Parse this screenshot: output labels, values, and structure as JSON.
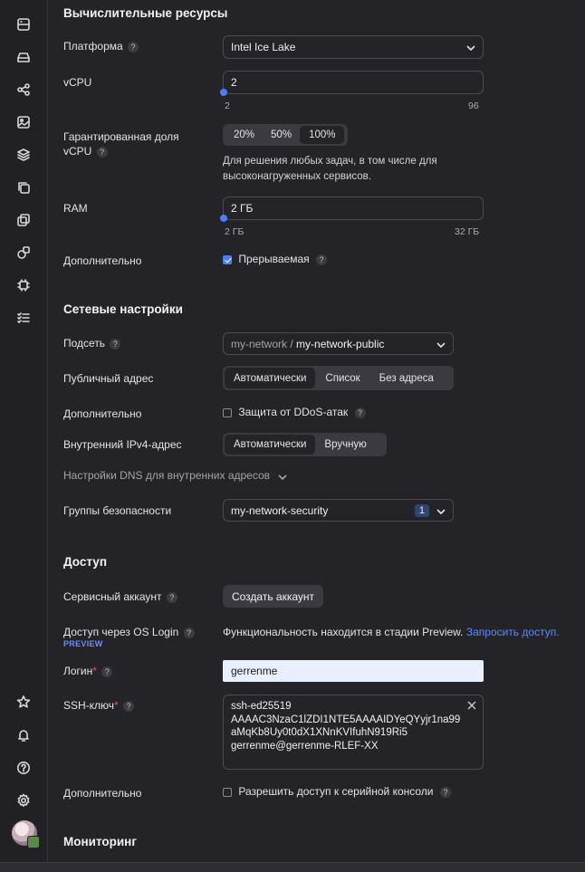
{
  "sidebar": {
    "icons": [
      "compute-icon",
      "disk-icon",
      "network-icon",
      "image-icon",
      "layers-icon",
      "copy-icon",
      "clone-icon",
      "shapes-icon",
      "chip-icon",
      "list-check-icon"
    ],
    "bottom_icons": [
      "star-icon",
      "bell-icon",
      "help-icon",
      "settings-icon"
    ]
  },
  "compute": {
    "title": "Вычислительные ресурсы",
    "platform_label": "Платформа",
    "platform_value": "Intel Ice Lake",
    "vcpu_label": "vCPU",
    "vcpu_value": "2",
    "vcpu_min": "2",
    "vcpu_max": "96",
    "guaranteed_label_1": "Гарантированная доля",
    "guaranteed_label_2": "vCPU",
    "guaranteed_options": [
      "20%",
      "50%",
      "100%"
    ],
    "guaranteed_selected": "100%",
    "guaranteed_help_1": "Для решения любых задач, в том числе для",
    "guaranteed_help_2": "высоконагруженных сервисов.",
    "ram_label": "RAM",
    "ram_value": "2 ГБ",
    "ram_min": "2 ГБ",
    "ram_max": "32 ГБ",
    "extra_label": "Дополнительно",
    "preemptible_label": "Прерываемая",
    "preemptible_checked": true
  },
  "network": {
    "title": "Сетевые настройки",
    "subnet_label": "Подсеть",
    "subnet_prefix": "my-network /",
    "subnet_value": "my-network-public",
    "public_address_label": "Публичный адрес",
    "public_address_options": [
      "Автоматически",
      "Список",
      "Без адреса"
    ],
    "public_address_selected": "Автоматически",
    "extra_label": "Дополнительно",
    "ddos_label": "Защита от DDoS-атак",
    "ddos_checked": false,
    "internal_ipv4_label": "Внутренний IPv4-адрес",
    "internal_ipv4_options": [
      "Автоматически",
      "Вручную"
    ],
    "internal_ipv4_selected": "Автоматически",
    "dns_settings_label": "Настройки DNS для внутренних адресов",
    "security_groups_label": "Группы безопасности",
    "security_groups_value": "my-network-security",
    "security_groups_count": "1"
  },
  "access": {
    "title": "Доступ",
    "service_account_label": "Сервисный аккаунт",
    "create_account_button": "Создать аккаунт",
    "os_login_label": "Доступ через OS Login",
    "os_login_badge": "PREVIEW",
    "os_login_text": "Функциональность находится в стадии Preview.",
    "os_login_link": "Запросить доступ.",
    "login_label": "Логин",
    "login_value": "gerrenme",
    "ssh_label": "SSH-ключ",
    "ssh_lines": [
      "ssh-ed25519",
      "AAAAC3NzaC1lZDI1NTE5AAAAIDYeQYyjr1na99",
      "aMqKb8Uy0t0dX1XNnKVIfuhN919Ri5",
      "gerrenme@gerrenme-RLEF-XX"
    ],
    "extra_label": "Дополнительно",
    "serial_console_label": "Разрешить доступ к серийной консоли",
    "serial_console_checked": false
  },
  "monitoring": {
    "title": "Мониторинг"
  },
  "colors": {
    "accent": "#4c7dff",
    "background": "#232328",
    "required": "#e0555a"
  }
}
